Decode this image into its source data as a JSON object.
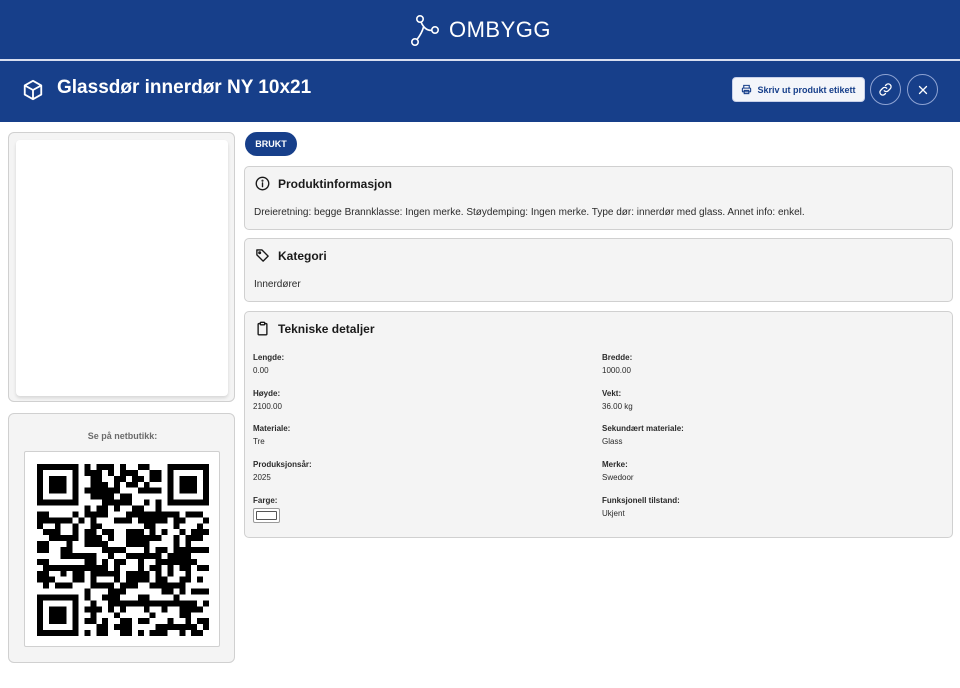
{
  "brand": {
    "name": "OMBYGG"
  },
  "header": {
    "title": "Glassdør innerdør NY 10x21",
    "print_label": "Skriv ut produkt etikett"
  },
  "qr": {
    "label": "Se på netbutikk:"
  },
  "badge": {
    "condition": "BRUKT"
  },
  "product_info": {
    "title": "Produktinformasjon",
    "text": "Dreieretning: begge Brannklasse: Ingen merke. Støydemping: Ingen merke. Type dør: innerdør med glass. Annet info: enkel."
  },
  "category": {
    "title": "Kategori",
    "value": "Innerdører"
  },
  "technical": {
    "title": "Tekniske detaljer",
    "left": [
      {
        "label": "Lengde:",
        "value": "0.00"
      },
      {
        "label": "Høyde:",
        "value": "2100.00"
      },
      {
        "label": "Materiale:",
        "value": "Tre"
      },
      {
        "label": "Produksjonsår:",
        "value": "2025"
      },
      {
        "label": "Farge:",
        "value": ""
      }
    ],
    "right": [
      {
        "label": "Bredde:",
        "value": "1000.00"
      },
      {
        "label": "Vekt:",
        "value": "36.00 kg"
      },
      {
        "label": "Sekundært materiale:",
        "value": "Glass"
      },
      {
        "label": "Merke:",
        "value": "Swedoor"
      },
      {
        "label": "Funksjonell tilstand:",
        "value": "Ukjent"
      }
    ]
  },
  "colors": {
    "brand_blue": "#173f8a",
    "panel_bg": "#f4f4f4",
    "swatch": "#ffffff"
  },
  "icons": {
    "logo": "molecule-logo-icon",
    "title": "box-icon",
    "print": "printer-icon",
    "link": "link-icon",
    "close": "close-icon",
    "info": "info-icon",
    "category": "tag-icon",
    "technical": "clipboard-icon"
  }
}
